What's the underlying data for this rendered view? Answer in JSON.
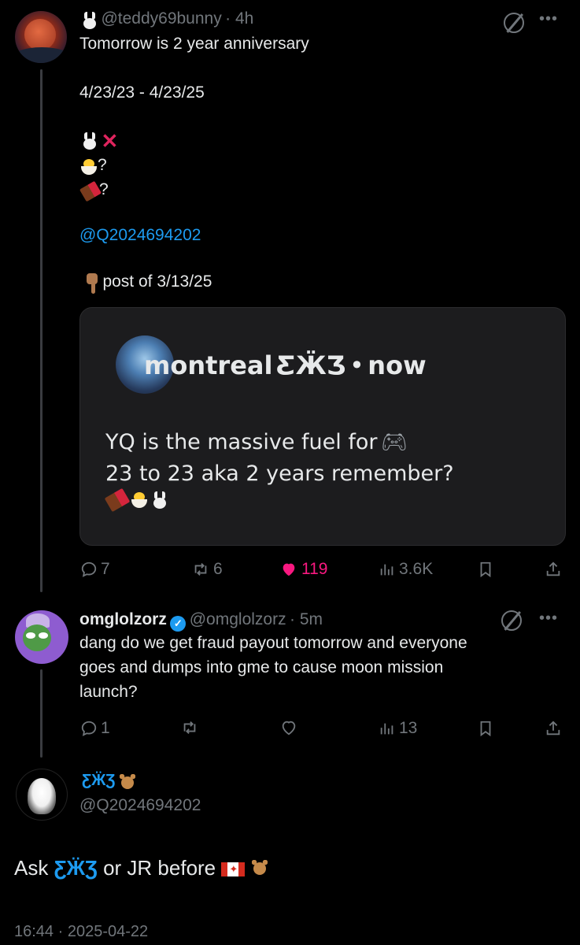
{
  "post1": {
    "handle": "@teddy69bunny",
    "time": "· 4h",
    "line1": "Tomorrow is 2 year anniversary",
    "dates": "4/23/23 - 4/23/25",
    "q1": "?",
    "q2": "?",
    "mention": "@Q2024694202",
    "ref": "post of 3/13/25",
    "icons": [
      "bunny-emoji",
      "cross-mark-emoji",
      "hatching-chick-emoji",
      "chocolate-bar-emoji",
      "backhand-index-down-emoji"
    ]
  },
  "quote_card": {
    "name": "montreal",
    "sep": "•",
    "time": "now",
    "line1": "YQ is the massive  fuel for",
    "line2": "23 to 23 aka 2 years remember?",
    "icons": [
      "butterfly-emoji",
      "game-controller-emoji",
      "chocolate-bar-emoji",
      "hatching-chick-emoji",
      "bunny-emoji"
    ]
  },
  "post1_actions": {
    "replies": "7",
    "reposts": "6",
    "likes": "119",
    "views": "3.6K"
  },
  "post2": {
    "name": "omglolzorz",
    "handle": "@omglolzorz",
    "time": "· 5m",
    "line1": "dang do we get fraud payout tomorrow and everyone",
    "line2": "goes and dumps into gme to cause moon mission",
    "line3": "launch?"
  },
  "post2_actions": {
    "replies": "1",
    "reposts": "",
    "likes": "",
    "views": "13"
  },
  "post3": {
    "handle": "@Q2024694202",
    "body_start": "Ask",
    "body_mid": "or JR before",
    "footer": "16:44 · 2025-04-22",
    "icons": [
      "butterfly-emoji",
      "teddy-bear-emoji",
      "canada-flag-emoji"
    ]
  },
  "colors": {
    "background": "#000000",
    "text": "#e7e9ea",
    "muted": "#71767b",
    "link": "#1d9bf0",
    "like": "#f91880",
    "card": "#1c1c1e"
  }
}
